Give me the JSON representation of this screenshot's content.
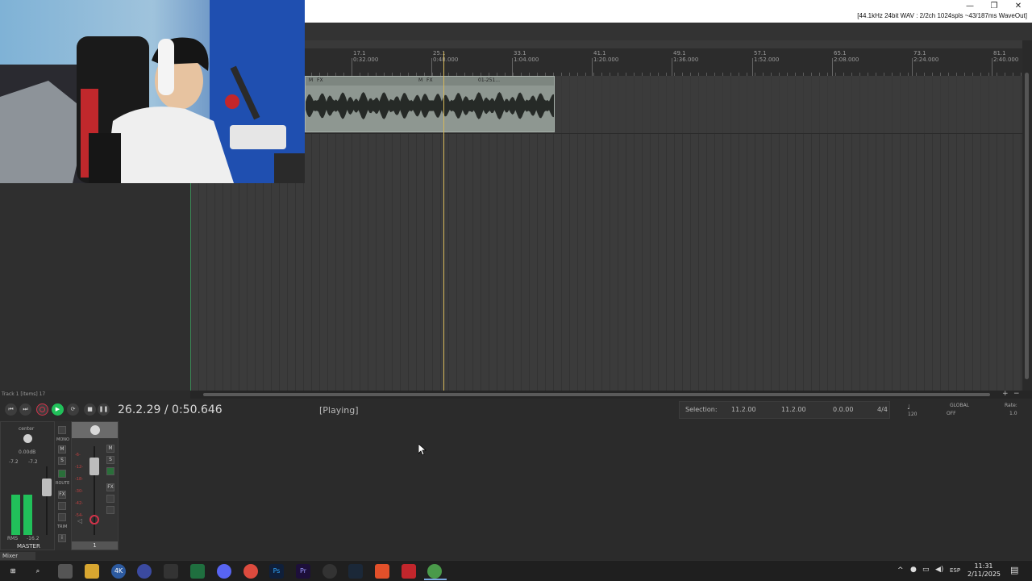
{
  "titlebar": {
    "status": "[44.1kHz 24bit WAV : 2/2ch 1024spls ~43/187ms WaveOut]",
    "minimize": "—",
    "restore": "❐",
    "close": "✕"
  },
  "ruler": {
    "markers": [
      {
        "bar": "17.1",
        "time": "0:32.000"
      },
      {
        "bar": "25.1",
        "time": "0:48.000"
      },
      {
        "bar": "33.1",
        "time": "1:04.000"
      },
      {
        "bar": "41.1",
        "time": "1:20.000"
      },
      {
        "bar": "49.1",
        "time": "1:36.000"
      },
      {
        "bar": "57.1",
        "time": "1:52.000"
      },
      {
        "bar": "65.1",
        "time": "2:08.000"
      },
      {
        "bar": "73.1",
        "time": "2:24.000"
      },
      {
        "bar": "81.1",
        "time": "2:40.000"
      }
    ]
  },
  "item": {
    "label": "01-251...",
    "buttons": [
      "M",
      "FX"
    ]
  },
  "tcp": {
    "footer": "Track 1 [items] 17"
  },
  "transport": {
    "time": "26.2.29 / 0:50.646",
    "state": "[Playing]",
    "selection_label": "Selection:",
    "sel_start": "11.2.00",
    "sel_end": "11.2.00",
    "sel_length": "0.0.00",
    "timesig": "4/4",
    "bpm": "120",
    "global": "GLOBAL",
    "global_state": "OFF",
    "rate_label": "Rate:",
    "rate_value": "1.0"
  },
  "mixer": {
    "master": {
      "pan": "center",
      "volume": "0.00dB",
      "peak_l": "-7.2",
      "peak_r": "-7.2",
      "rms": "RMS",
      "rms_value": "-16.2",
      "name": "MASTER",
      "mono": "MONO",
      "m": "M",
      "s": "S",
      "route": "ROUTE",
      "fx": "FX",
      "trim": "TRIM",
      "info": "i"
    },
    "track1": {
      "number": "1",
      "m": "M",
      "s": "S",
      "fx": "FX",
      "scale": [
        "-6-",
        "-12-",
        "-18-",
        "-30-",
        "-42-",
        "-54-"
      ]
    },
    "tab": "Mixer"
  },
  "taskbar": {
    "apps": [
      "4K",
      "Ps",
      "Pr"
    ],
    "lang": "ESP",
    "time": "11:31",
    "date": "2/11/2025"
  },
  "colors": {
    "accent_green": "#21c05a",
    "play_cursor": "#d7b85a",
    "record_red": "#d2334a"
  }
}
